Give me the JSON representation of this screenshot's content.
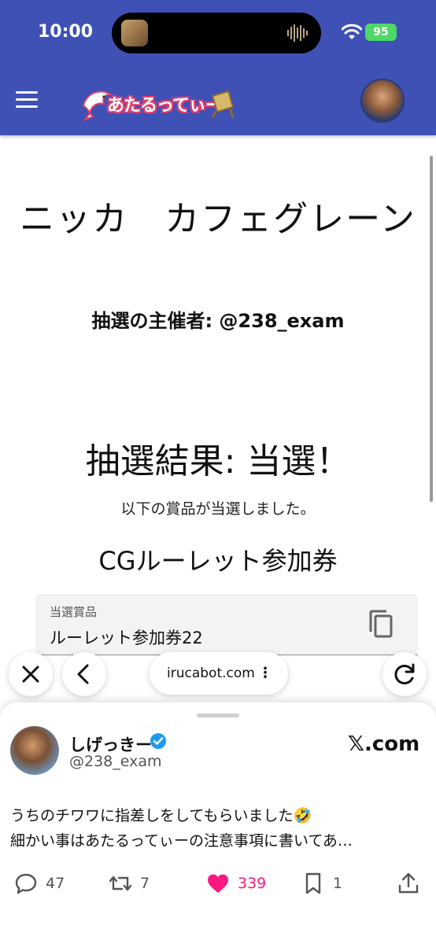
{
  "status_bar": {
    "time": "10:00",
    "battery": "95"
  },
  "app": {
    "brand": "あたるってぃー"
  },
  "page": {
    "title": "ニッカ　カフェグレーン",
    "organizer": "抽選の主催者: @238_exam",
    "result": "抽選結果: 当選！",
    "result_sub": "以下の賞品が当選しました。",
    "prize_name": "CGルーレット参加券",
    "prize_field": {
      "label": "当選賞品",
      "value": "ルーレット参加券22"
    }
  },
  "browser": {
    "url": "irucabot.com"
  },
  "tweet": {
    "author": "しげっきー",
    "handle": "@238_exam",
    "source": "𝕏.com",
    "line1": "うちのチワワに指差しをしてもらいました🤣",
    "line2": "細かい事はあたるってぃーの注意事項に書いてあ…",
    "replies": "47",
    "retweets": "7",
    "likes": "339",
    "bookmarks": "1"
  },
  "colors": {
    "header": "#3f51b5",
    "like": "#f91880",
    "verified": "#1d9bf0",
    "battery": "#4cd964"
  }
}
